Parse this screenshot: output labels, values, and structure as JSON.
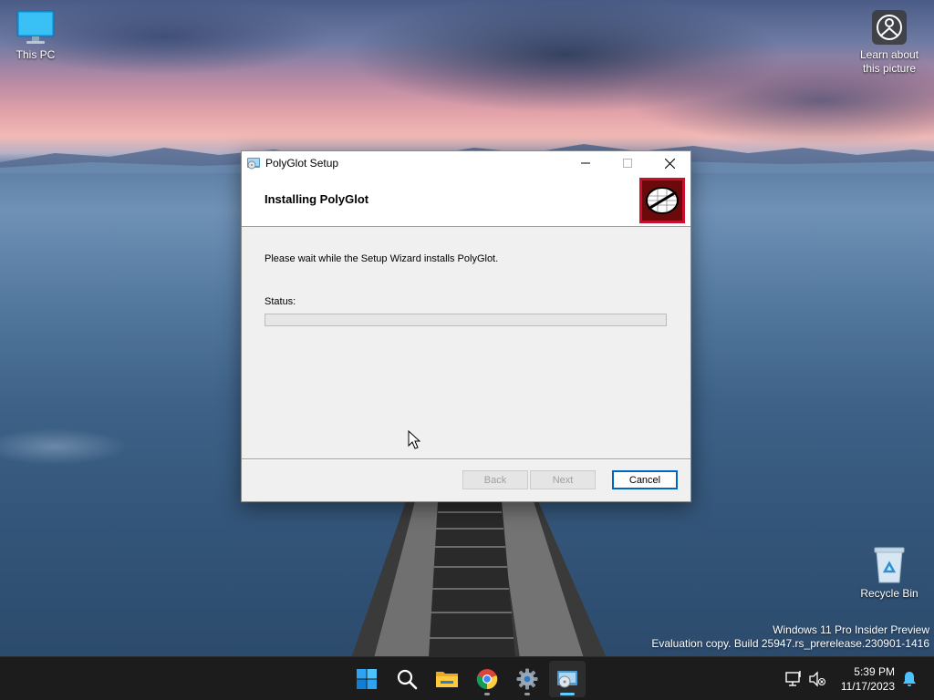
{
  "desktop": {
    "icons": [
      {
        "label": "This PC",
        "icon": "monitor-icon"
      },
      {
        "label": "Learn about this picture",
        "icon": "camera-icon"
      },
      {
        "label": "Recycle Bin",
        "icon": "recycle-bin-icon"
      }
    ],
    "watermark": {
      "line1": "Windows 11 Pro Insider Preview",
      "line2": "Evaluation copy. Build 25947.rs_prerelease.230901-1416"
    }
  },
  "window": {
    "title": "PolyGlot Setup",
    "heading": "Installing PolyGlot",
    "message": "Please wait while the Setup Wizard installs PolyGlot.",
    "status_label": "Status:",
    "progress": 0,
    "buttons": {
      "back": "Back",
      "next": "Next",
      "cancel": "Cancel"
    }
  },
  "taskbar": {
    "apps": [
      {
        "name": "start",
        "icon": "windows-logo-icon"
      },
      {
        "name": "search",
        "icon": "search-icon"
      },
      {
        "name": "file-explorer",
        "icon": "folder-icon"
      },
      {
        "name": "chrome",
        "icon": "chrome-icon"
      },
      {
        "name": "settings",
        "icon": "gear-icon"
      },
      {
        "name": "setup",
        "icon": "installer-icon"
      }
    ],
    "clock": {
      "time": "5:39 PM",
      "date": "11/17/2023"
    }
  },
  "colors": {
    "accent": "#0067c0",
    "logo_red": "#c8102e",
    "taskbar": "#1c1c1c"
  }
}
